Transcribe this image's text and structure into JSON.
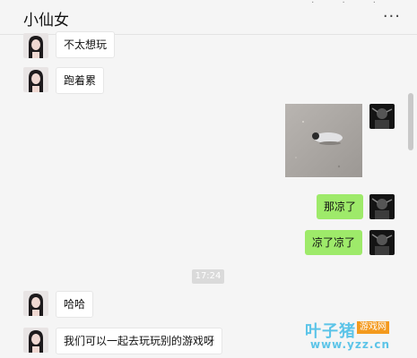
{
  "header": {
    "title": "小仙女",
    "more_label": "···",
    "window_dots": "·  ·  ·"
  },
  "messages": [
    {
      "side": "left",
      "type": "text",
      "text": "不太想玩"
    },
    {
      "side": "left",
      "type": "text",
      "text": "跑着累"
    },
    {
      "side": "right",
      "type": "image",
      "image_desc": "photo"
    },
    {
      "side": "right",
      "type": "text",
      "text": "那凉了"
    },
    {
      "side": "right",
      "type": "text",
      "text": "凉了凉了"
    },
    {
      "side": "left",
      "type": "text",
      "text": "哈哈"
    },
    {
      "side": "left",
      "type": "text",
      "text": "我们可以一起去玩玩别的游戏呀"
    }
  ],
  "timestamp": "17:24",
  "watermark": {
    "name": "叶子猪",
    "tag": "游戏网",
    "url": "www.yzz.cn"
  },
  "colors": {
    "sent_bubble": "#9eea6a",
    "received_bubble": "#ffffff",
    "background": "#f5f5f5",
    "watermark_blue": "#5cc4e8",
    "watermark_orange": "#f39a1e"
  }
}
